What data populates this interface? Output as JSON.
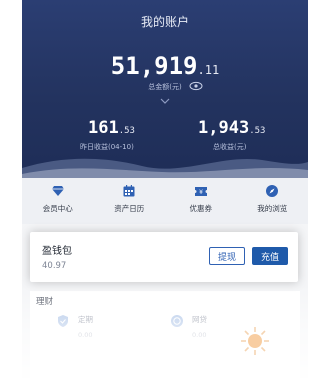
{
  "header": {
    "title": "我的账户",
    "total_int": "51,919",
    "total_dec": ".11",
    "total_label": "总金额(元)",
    "yesterday_int": "161",
    "yesterday_dec": ".53",
    "yesterday_label": "昨日收益(04-10)",
    "income_int": "1,943",
    "income_dec": ".53",
    "income_label": "总收益(元)"
  },
  "quick": {
    "member": "会员中心",
    "calendar": "资产日历",
    "coupon": "优惠券",
    "browse": "我的浏览"
  },
  "wallet": {
    "title": "盈钱包",
    "amount": "40.97",
    "withdraw_label": "提现",
    "recharge_label": "充值"
  },
  "licai": {
    "title": "理财",
    "products": [
      {
        "name": "定期",
        "value": "0.00"
      },
      {
        "name": "网贷",
        "value": "0.00"
      }
    ]
  },
  "colors": {
    "header_bg": "#2b3e73",
    "accent_blue": "#1f5aaa",
    "icon_blue": "#2f61b3"
  },
  "icons": [
    "eye-icon",
    "chevron-down-icon",
    "diamond-icon",
    "calendar-icon",
    "coupon-icon",
    "compass-icon",
    "sun-icon"
  ]
}
